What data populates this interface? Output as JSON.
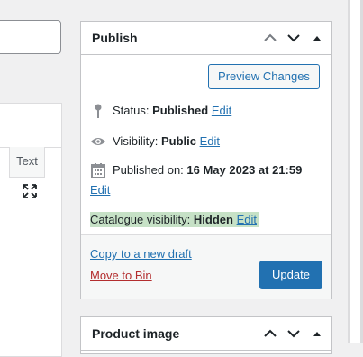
{
  "editor": {
    "text_tab": "Text"
  },
  "publish": {
    "title": "Publish",
    "preview_button": "Preview Changes",
    "status_label": "Status:",
    "status_value": "Published",
    "visibility_label": "Visibility:",
    "visibility_value": "Public",
    "published_label": "Published on:",
    "published_value": "16 May 2023 at 21:59",
    "edit": "Edit",
    "catalogue_label": "Catalogue visibility:",
    "catalogue_value": "Hidden",
    "copy_draft": "Copy to a new draft",
    "move_to_bin": "Move to Bin",
    "update_button": "Update"
  },
  "product_image": {
    "title": "Product image"
  },
  "colors": {
    "accent": "#2271b1",
    "danger": "#b32d2e",
    "highlight": "#c6e1c6"
  }
}
